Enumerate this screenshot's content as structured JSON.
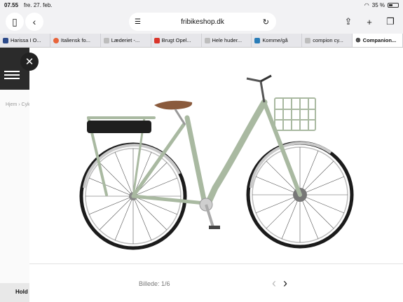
{
  "status_bar": {
    "time": "07.55",
    "date": "fre. 27. feb.",
    "battery": "35 %"
  },
  "browser": {
    "url": "fribikeshop.dk",
    "tabs": [
      {
        "label": "Harissa I O...",
        "color": "#2c4a8a"
      },
      {
        "label": "Italiensk fo...",
        "color": "#e8643a"
      },
      {
        "label": "Læderiet -...",
        "color": "#bdbdbd"
      },
      {
        "label": "Brugt Opel...",
        "color": "#d9352b"
      },
      {
        "label": "Hele huder...",
        "color": "#bdbdbd"
      },
      {
        "label": "Komme/gå",
        "color": "#2a7db8"
      },
      {
        "label": "compion cy...",
        "color": "#bdbdbd"
      },
      {
        "label": "Companion...",
        "color": "#222222"
      }
    ]
  },
  "page": {
    "breadcrumb": "Hjem › Cyk",
    "hold_label": "Hold"
  },
  "gallery": {
    "counter": "Billede: 1/6"
  },
  "colors": {
    "frame": "#a9b9a1",
    "saddle": "#8a5a3c",
    "tire": "#1b1b1b"
  }
}
